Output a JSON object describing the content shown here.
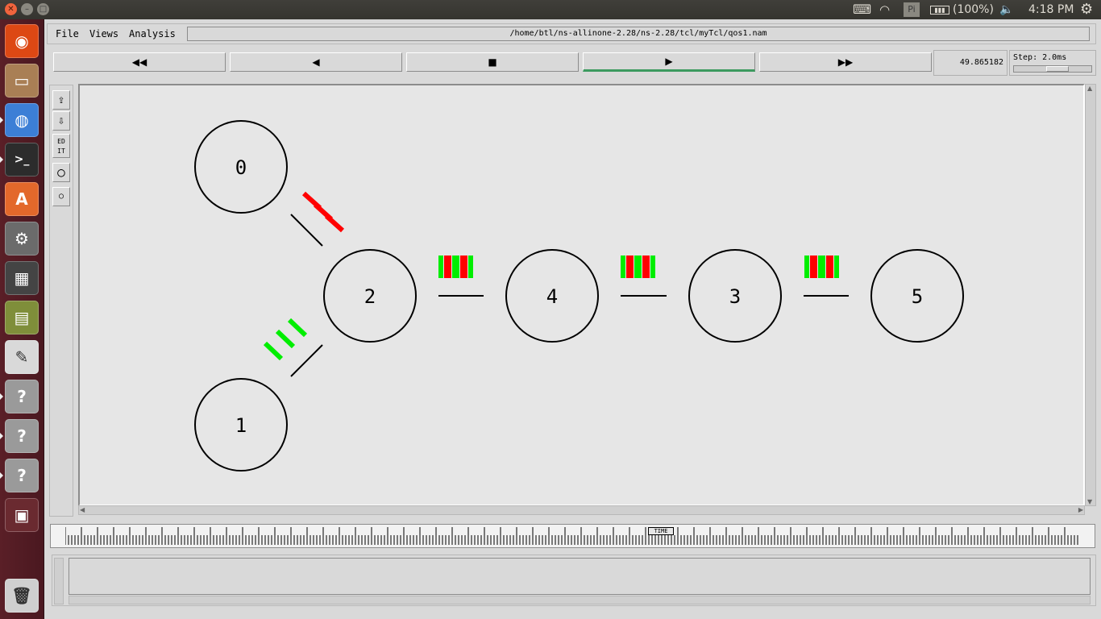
{
  "top_panel": {
    "battery": "(100%)",
    "clock": "4:18 PM",
    "icons": [
      "keyboard-icon",
      "wifi-icon",
      "pi-icon",
      "battery-icon",
      "volume-icon",
      "gear-icon"
    ],
    "pi_label": "Pi"
  },
  "launcher": {
    "items": [
      {
        "name": "ubuntu-dash-icon",
        "color": "#dd4814",
        "glyph": "◉"
      },
      {
        "name": "files-icon",
        "color": "#a97f55",
        "glyph": "▭"
      },
      {
        "name": "chromium-icon",
        "color": "#3c7fd6",
        "glyph": "◍"
      },
      {
        "name": "terminal-icon",
        "color": "#2c2c2c",
        "glyph": ">_"
      },
      {
        "name": "software-center-icon",
        "color": "#e3682b",
        "glyph": "A"
      },
      {
        "name": "system-settings-icon",
        "color": "#6b6b6b",
        "glyph": "⚙"
      },
      {
        "name": "workspaces-icon",
        "color": "#444",
        "glyph": "▦"
      },
      {
        "name": "book-icon",
        "color": "#7f8e3a",
        "glyph": "▤"
      },
      {
        "name": "text-editor-icon",
        "color": "#d9d9d9",
        "glyph": "✎"
      },
      {
        "name": "unknown-app-icon",
        "color": "#9a9a9a",
        "glyph": "?"
      },
      {
        "name": "unknown-app-icon",
        "color": "#9a9a9a",
        "glyph": "?"
      },
      {
        "name": "unknown-app-icon",
        "color": "#9a9a9a",
        "glyph": "?"
      },
      {
        "name": "window-switcher-icon",
        "color": "#6a2a30",
        "glyph": "▣"
      },
      {
        "name": "trash-icon",
        "color": "#cfcfcf",
        "glyph": "🗑"
      }
    ]
  },
  "menu": {
    "file": "File",
    "views": "Views",
    "analysis": "Analysis",
    "path": "/home/btl/ns-allinone-2.28/ns-2.28/tcl/myTcl/qos1.nam"
  },
  "controls": {
    "rewind": "◀◀",
    "back": "◀",
    "stop": "■",
    "play": "▶",
    "fast_forward": "▶▶",
    "time": "49.865182",
    "step": "Step: 2.0ms"
  },
  "tools": {
    "zoom_in": "⇪",
    "zoom_out": "⇩",
    "edit": "ED IT",
    "big_circle": "○",
    "small_circle": "○"
  },
  "timeline": {
    "marker": "TIME"
  },
  "graph": {
    "nodes": [
      {
        "id": "0",
        "label": "0"
      },
      {
        "id": "1",
        "label": "1"
      },
      {
        "id": "2",
        "label": "2"
      },
      {
        "id": "4",
        "label": "4"
      },
      {
        "id": "3",
        "label": "3"
      },
      {
        "id": "5",
        "label": "5"
      }
    ],
    "links": [
      {
        "from": "0",
        "to": "2"
      },
      {
        "from": "1",
        "to": "2"
      },
      {
        "from": "2",
        "to": "4"
      },
      {
        "from": "4",
        "to": "3"
      },
      {
        "from": "3",
        "to": "5"
      }
    ],
    "colors": {
      "flow_red": "#ff0000",
      "flow_green": "#00ee00",
      "node_stroke": "#000000",
      "canvas_bg": "#e6e6e6"
    }
  }
}
